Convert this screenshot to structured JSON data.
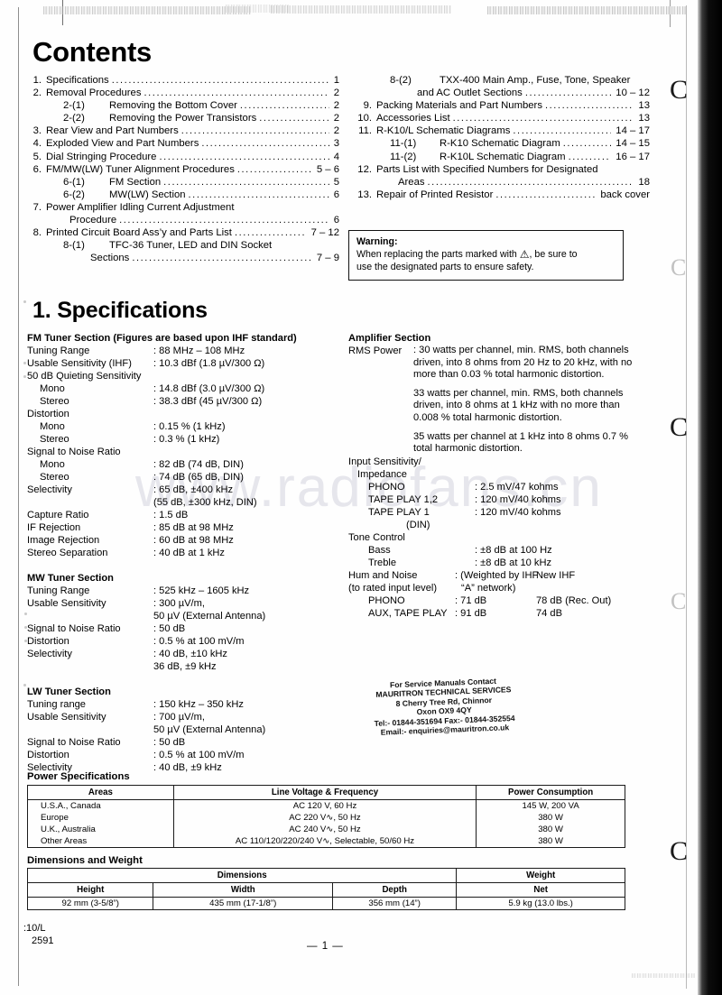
{
  "document": {
    "contents_heading": "Contents",
    "spec_heading": "1. Specifications",
    "footer_code_line1": ":10/L",
    "footer_code_line2": "2591",
    "page_number": "— 1 —",
    "watermark": "www.radiofans.cn"
  },
  "toc": {
    "column1": [
      {
        "num": "1.",
        "text": "Specifications",
        "page": "1"
      },
      {
        "num": "2.",
        "text": "Removal Procedures",
        "page": "2"
      },
      {
        "num": "",
        "sub": "2-(1)",
        "text": "Removing the Bottom Cover",
        "page": "2"
      },
      {
        "num": "",
        "sub": "2-(2)",
        "text": "Removing the Power Transistors",
        "page": "2"
      },
      {
        "num": "3.",
        "text": "Rear View and Part Numbers",
        "page": "2"
      },
      {
        "num": "4.",
        "text": "Exploded View and Part Numbers",
        "page": "3"
      },
      {
        "num": "5.",
        "text": "Dial Stringing Procedure",
        "page": "4"
      },
      {
        "num": "6.",
        "text": "FM/MW(LW) Tuner Alignment Procedures",
        "page": "5 – 6"
      },
      {
        "num": "",
        "sub": "6-(1)",
        "text": "FM Section",
        "page": "5"
      },
      {
        "num": "",
        "sub": "6-(2)",
        "text": "MW(LW) Section",
        "page": "6"
      },
      {
        "num": "7.",
        "text": "Power Amplifier Idling Current Adjustment",
        "page": ""
      },
      {
        "num": "",
        "cont": "Procedure",
        "page": "6"
      },
      {
        "num": "8.",
        "text": "Printed Circuit Board Ass’y and Parts List",
        "page": "7 – 12"
      },
      {
        "num": "",
        "sub": "8-(1)",
        "text": "TFC-36 Tuner, LED and DIN Socket",
        "page": ""
      },
      {
        "num": "",
        "cont2": "Sections",
        "page": "7 – 9"
      }
    ],
    "column2": [
      {
        "num": "",
        "sub": "8-(2)",
        "text": "TXX-400 Main Amp., Fuse, Tone, Speaker",
        "page": ""
      },
      {
        "num": "",
        "cont2": "and AC Outlet Sections",
        "page": "10 – 12"
      },
      {
        "num": "9.",
        "text": "Packing Materials and Part Numbers",
        "page": "13"
      },
      {
        "num": "10.",
        "text": "Accessories List",
        "page": "13"
      },
      {
        "num": "11.",
        "text": "R-K10/L Schematic Diagrams",
        "page": "14 – 17"
      },
      {
        "num": "",
        "sub": "11-(1)",
        "text": "R-K10 Schematic Diagram",
        "page": "14 – 15"
      },
      {
        "num": "",
        "sub": "11-(2)",
        "text": "R-K10L Schematic Diagram",
        "page": "16 – 17"
      },
      {
        "num": "12.",
        "text": "Parts List with Specified Numbers for Designated",
        "page": ""
      },
      {
        "num": "",
        "cont": "Areas",
        "page": "18"
      },
      {
        "num": "13.",
        "text": "Repair of Printed Resistor",
        "page": "back cover"
      }
    ]
  },
  "warning": {
    "title": "Warning:",
    "line1_a": "When replacing the parts marked with",
    "triangle": "⚠",
    "line1_b": ", be sure to",
    "line2": "use the designated parts to ensure safety."
  },
  "fm_section": {
    "title": "FM Tuner Section (Figures are based upon IHF standard)",
    "rows": [
      {
        "key": "Tuning Range",
        "value": ": 88 MHz – 108 MHz"
      },
      {
        "key": "Usable Sensitivity (IHF)",
        "value": ": 10.3 dBf (1.8 µV/300 Ω)"
      },
      {
        "key": "50 dB Quieting Sensitivity",
        "value": ""
      },
      {
        "key": "Mono",
        "indent": true,
        "value": ": 14.8 dBf (3.0 µV/300 Ω)"
      },
      {
        "key": "Stereo",
        "indent": true,
        "value": ": 38.3 dBf (45 µV/300 Ω)"
      },
      {
        "key": "Distortion",
        "value": ""
      },
      {
        "key": "Mono",
        "indent": true,
        "value": ": 0.15 % (1 kHz)"
      },
      {
        "key": "Stereo",
        "indent": true,
        "value": ": 0.3 % (1 kHz)"
      },
      {
        "key": "Signal to Noise Ratio",
        "value": ""
      },
      {
        "key": "Mono",
        "indent": true,
        "value": ": 82 dB (74 dB, DIN)"
      },
      {
        "key": "Stereo",
        "indent": true,
        "value": ": 74 dB (65 dB, DIN)"
      },
      {
        "key": "Selectivity",
        "value": ": 65 dB, ±400 kHz"
      },
      {
        "key": "",
        "cont": "(55 dB, ±300 kHz, DIN)"
      },
      {
        "key": "Capture Ratio",
        "value": ": 1.5 dB"
      },
      {
        "key": "IF Rejection",
        "value": ": 85 dB at 98 MHz"
      },
      {
        "key": "Image Rejection",
        "value": ": 60 dB at 98 MHz"
      },
      {
        "key": "Stereo Separation",
        "value": ": 40 dB at 1 kHz"
      }
    ]
  },
  "mw_section": {
    "title": "MW Tuner Section",
    "rows": [
      {
        "key": "Tuning Range",
        "value": ": 525 kHz – 1605 kHz"
      },
      {
        "key": "Usable Sensitivity",
        "value": ": 300 µV/m,"
      },
      {
        "key": "",
        "cont": "50 µV (External Antenna)"
      },
      {
        "key": "Signal to Noise Ratio",
        "value": ": 50 dB"
      },
      {
        "key": "Distortion",
        "value": ": 0.5 % at 100 mV/m"
      },
      {
        "key": "Selectivity",
        "value": ": 40 dB, ±10 kHz"
      },
      {
        "key": "",
        "cont": "36 dB, ±9 kHz"
      }
    ]
  },
  "lw_section": {
    "title": "LW Tuner Section",
    "rows": [
      {
        "key": "Tuning range",
        "value": ": 150 kHz – 350 kHz"
      },
      {
        "key": "Usable Sensitivity",
        "value": ": 700 µV/m,"
      },
      {
        "key": "",
        "cont": "50 µV (External Antenna)"
      },
      {
        "key": "Signal to Noise Ratio",
        "value": ": 50 dB"
      },
      {
        "key": "Distortion",
        "value": ": 0.5 % at 100 mV/m"
      },
      {
        "key": "Selectivity",
        "value": ": 40 dB, ±9 kHz"
      }
    ]
  },
  "amplifier_section": {
    "title": "Amplifier Section",
    "rms_label": "RMS Power",
    "rms_p1": ": 30 watts per channel, min. RMS, both channels driven, into 8 ohms from 20 Hz to 20 kHz, with no more than 0.03 % total harmonic distortion.",
    "rms_p2": "33 watts per channel, min. RMS, both channels driven, into 8 ohms at 1 kHz with no more than 0.008 % total harmonic distortion.",
    "rms_p3": "35 watts per channel at 1 kHz into 8 ohms 0.7 % total harmonic distortion.",
    "input_sens_title": "Input Sensitivity/",
    "impedance_title": "Impedance",
    "inputs": [
      {
        "key": "PHONO",
        "value": ": 2.5 mV/47 kohms"
      },
      {
        "key": "TAPE PLAY 1,2",
        "value": ": 120 mV/40 kohms"
      },
      {
        "key": "TAPE PLAY 1",
        "value": ": 120 mV/40 kohms"
      },
      {
        "key": "(DIN)",
        "value": "",
        "din": true
      }
    ],
    "tone_title": "Tone Control",
    "tone": [
      {
        "key": "Bass",
        "value": ": ±8 dB at 100 Hz"
      },
      {
        "key": "Treble",
        "value": ": ±8 dB at 10 kHz"
      }
    ],
    "hum_title": "Hum and Noise",
    "hum_sub": "(to rated input level)",
    "hum_head_val": ": (Weighted by IHF",
    "hum_head_val2": "New IHF",
    "hum_head_cont": "“A” network)",
    "hum_rows": [
      {
        "key": "PHONO",
        "v1": ": 71 dB",
        "v2": "78 dB (Rec. Out)"
      },
      {
        "key": "AUX, TAPE PLAY",
        "v1": ": 91 dB",
        "v2": "74 dB"
      }
    ]
  },
  "stamp": {
    "l1": "For Service Manuals Contact",
    "l2": "MAURITRON TECHNICAL SERVICES",
    "l3": "8 Cherry Tree Rd, Chinnor",
    "l4": "Oxon OX9 4QY",
    "l5": "Tel:- 01844-351694 Fax:- 01844-352554",
    "l6": "Email:- enquiries@mauritron.co.uk"
  },
  "power_specs": {
    "caption": "Power Specifications",
    "headers": [
      "Areas",
      "Line Voltage & Frequency",
      "Power Consumption"
    ],
    "rows": [
      [
        "U.S.A., Canada",
        "AC 120 V, 60 Hz",
        "145 W, 200 VA"
      ],
      [
        "Europe",
        "AC 220 V∿, 50 Hz",
        "380 W"
      ],
      [
        "U.K., Australia",
        "AC 240 V∿, 50 Hz",
        "380 W"
      ],
      [
        "Other Areas",
        "AC 110/120/220/240 V∿, Selectable, 50/60 Hz",
        "380 W"
      ]
    ]
  },
  "dimensions": {
    "caption": "Dimensions and Weight",
    "group_dimensions": "Dimensions",
    "group_weight": "Weight",
    "subheaders": [
      "Height",
      "Width",
      "Depth",
      "Net"
    ],
    "values": [
      "92 mm (3-5/8”)",
      "435 mm (17-1/8”)",
      "356 mm (14”)",
      "5.9 kg (13.0 lbs.)"
    ]
  }
}
